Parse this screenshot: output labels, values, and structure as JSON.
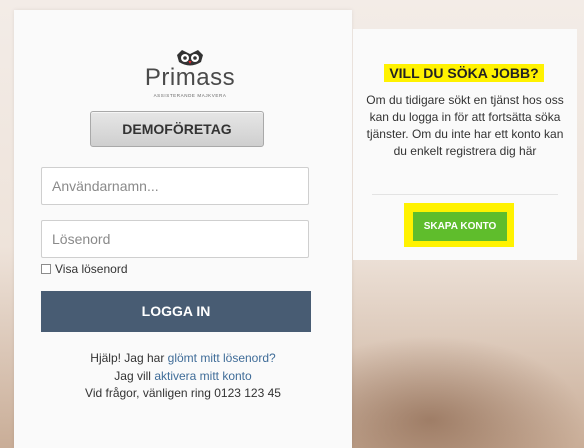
{
  "brand": {
    "logo_text": "Primass",
    "logo_subtext": "ASSISTERANDE MAJKVERA"
  },
  "demo_button": {
    "label": "DEMOFÖRETAG"
  },
  "login": {
    "username_placeholder": "Användarnamn...",
    "password_placeholder": "Lösenord",
    "show_password_label": "Visa lösenord",
    "login_button_label": "LOGGA IN"
  },
  "help": {
    "forgot_prefix": "Hjälp! Jag har ",
    "forgot_link": "glömt mitt lösenord?",
    "activate_prefix": "Jag vill ",
    "activate_link": "aktivera mitt konto",
    "contact": "Vid frågor, vänligen ring 0123 123 45"
  },
  "job": {
    "title": "VILL DU SÖKA JOBB?",
    "text": "Om du tidigare sökt en tjänst hos oss kan du logga in för att fortsätta söka tjänster. Om du inte har ett konto kan du enkelt registrera dig här",
    "create_button_label": "SKAPA KONTO"
  },
  "colors": {
    "login_button": "#485c73",
    "highlight": "#fff200",
    "create_button": "#5fbd2c",
    "link": "#3f6c98"
  }
}
